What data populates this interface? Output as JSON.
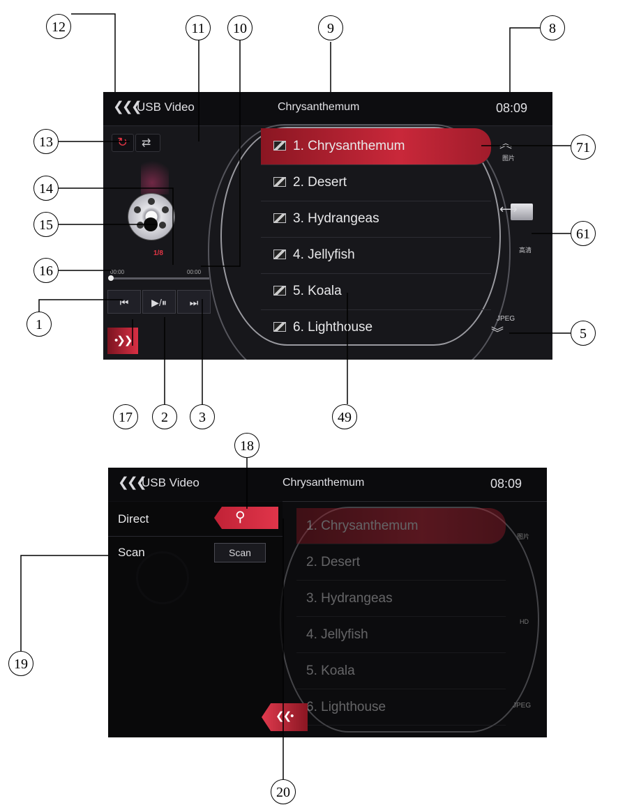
{
  "screen1": {
    "title_bar": {
      "source": "USB Video",
      "track": "Chrysanthemum",
      "clock": "08:09"
    },
    "left_panel": {
      "counter": "1/8",
      "time_elapsed": "00:00",
      "time_total": "00:00"
    },
    "controls": {
      "prev": "⏮",
      "play_pause": "▶/⏸",
      "next": "⏭"
    },
    "list": [
      {
        "label": "1. Chrysanthemum",
        "selected": true
      },
      {
        "label": "2. Desert"
      },
      {
        "label": "3. Hydrangeas"
      },
      {
        "label": "4. Jellyfish"
      },
      {
        "label": "5. Koala"
      },
      {
        "label": "6. Lighthouse"
      }
    ],
    "right_panel": {
      "up_label": "图片",
      "folder_label": "高清",
      "down_label": "JPEG"
    }
  },
  "screen2": {
    "title_bar": {
      "source": "USB Video",
      "track": "Chrysanthemum",
      "clock": "08:09"
    },
    "menu": {
      "direct_label": "Direct",
      "scan_label": "Scan",
      "scan_button": "Scan"
    },
    "list": [
      "1. Chrysanthemum",
      "2. Desert",
      "3. Hydrangeas",
      "4. Jellyfish",
      "5. Koala",
      "6. Lighthouse"
    ],
    "right_panel": {
      "up_label": "图片",
      "folder_label": "HD",
      "down_label": "JPEG"
    }
  },
  "callouts": {
    "c1": "1",
    "c2": "2",
    "c3": "3",
    "c5": "5",
    "c8": "8",
    "c9": "9",
    "c10": "10",
    "c11": "11",
    "c12": "12",
    "c13": "13",
    "c14": "14",
    "c15": "15",
    "c16": "16",
    "c17": "17",
    "c18": "18",
    "c19": "19",
    "c20": "20",
    "c49": "49",
    "c61": "61",
    "c71": "71"
  },
  "colors": {
    "accent_red": "#c9283a",
    "screen_bg": "#17171b",
    "text_light": "#e8e8ea"
  }
}
